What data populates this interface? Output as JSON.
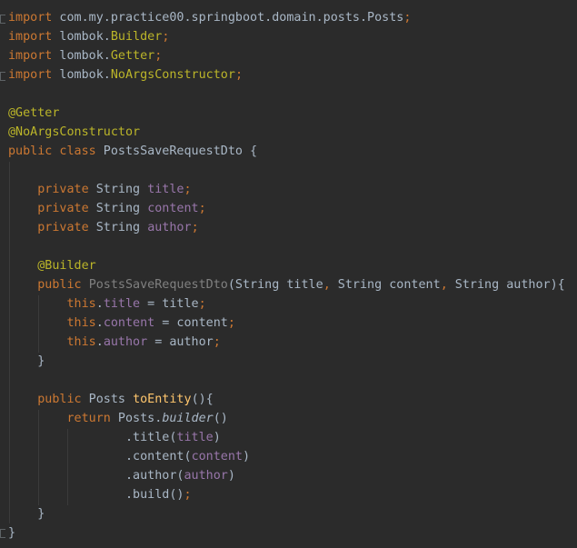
{
  "editor": {
    "colors": {
      "background": "#2b2b2b",
      "keyword": "#cc7832",
      "annotation": "#bbb529",
      "field": "#9876aa",
      "method": "#ffc66d",
      "plain": "#a9b7c6",
      "gray": "#808080"
    },
    "lines": [
      [
        {
          "t": "import",
          "c": "kw"
        },
        {
          "t": " com.my.practice00.springboot.domain.posts.Posts",
          "c": "plain"
        },
        {
          "t": ";",
          "c": "kw"
        }
      ],
      [
        {
          "t": "import",
          "c": "kw"
        },
        {
          "t": " lombok.",
          "c": "plain"
        },
        {
          "t": "Builder",
          "c": "ann"
        },
        {
          "t": ";",
          "c": "kw"
        }
      ],
      [
        {
          "t": "import",
          "c": "kw"
        },
        {
          "t": " lombok.",
          "c": "plain"
        },
        {
          "t": "Getter",
          "c": "ann"
        },
        {
          "t": ";",
          "c": "kw"
        }
      ],
      [
        {
          "t": "import",
          "c": "kw"
        },
        {
          "t": " lombok.",
          "c": "plain"
        },
        {
          "t": "NoArgsConstructor",
          "c": "ann"
        },
        {
          "t": ";",
          "c": "kw"
        }
      ],
      [],
      [
        {
          "t": "@Getter",
          "c": "ann"
        }
      ],
      [
        {
          "t": "@NoArgsConstructor",
          "c": "ann"
        }
      ],
      [
        {
          "t": "public class",
          "c": "kw"
        },
        {
          "t": " PostsSaveRequestDto {",
          "c": "plain"
        }
      ],
      [],
      [
        {
          "t": "    "
        },
        {
          "t": "private",
          "c": "kw"
        },
        {
          "t": " String ",
          "c": "plain"
        },
        {
          "t": "title",
          "c": "field"
        },
        {
          "t": ";",
          "c": "kw"
        }
      ],
      [
        {
          "t": "    "
        },
        {
          "t": "private",
          "c": "kw"
        },
        {
          "t": " String ",
          "c": "plain"
        },
        {
          "t": "content",
          "c": "field"
        },
        {
          "t": ";",
          "c": "kw"
        }
      ],
      [
        {
          "t": "    "
        },
        {
          "t": "private",
          "c": "kw"
        },
        {
          "t": " String ",
          "c": "plain"
        },
        {
          "t": "author",
          "c": "field"
        },
        {
          "t": ";",
          "c": "kw"
        }
      ],
      [],
      [
        {
          "t": "    "
        },
        {
          "t": "@Builder",
          "c": "ann"
        }
      ],
      [
        {
          "t": "    "
        },
        {
          "t": "public",
          "c": "kw"
        },
        {
          "t": " ",
          "c": "plain"
        },
        {
          "t": "PostsSaveRequestDto",
          "c": "gray"
        },
        {
          "t": "(String title",
          "c": "plain"
        },
        {
          "t": ",",
          "c": "kw"
        },
        {
          "t": " String content",
          "c": "plain"
        },
        {
          "t": ",",
          "c": "kw"
        },
        {
          "t": " String author){",
          "c": "plain"
        }
      ],
      [
        {
          "t": "        "
        },
        {
          "t": "this",
          "c": "kw"
        },
        {
          "t": ".",
          "c": "plain"
        },
        {
          "t": "title",
          "c": "field"
        },
        {
          "t": " = title",
          "c": "plain"
        },
        {
          "t": ";",
          "c": "kw"
        }
      ],
      [
        {
          "t": "        "
        },
        {
          "t": "this",
          "c": "kw"
        },
        {
          "t": ".",
          "c": "plain"
        },
        {
          "t": "content",
          "c": "field"
        },
        {
          "t": " = content",
          "c": "plain"
        },
        {
          "t": ";",
          "c": "kw"
        }
      ],
      [
        {
          "t": "        "
        },
        {
          "t": "this",
          "c": "kw"
        },
        {
          "t": ".",
          "c": "plain"
        },
        {
          "t": "author",
          "c": "field"
        },
        {
          "t": " = author",
          "c": "plain"
        },
        {
          "t": ";",
          "c": "kw"
        }
      ],
      [
        {
          "t": "    }",
          "c": "plain"
        }
      ],
      [],
      [
        {
          "t": "    "
        },
        {
          "t": "public",
          "c": "kw"
        },
        {
          "t": " Posts ",
          "c": "plain"
        },
        {
          "t": "toEntity",
          "c": "fn"
        },
        {
          "t": "(){",
          "c": "plain"
        }
      ],
      [
        {
          "t": "        "
        },
        {
          "t": "return",
          "c": "kw"
        },
        {
          "t": " Posts.",
          "c": "plain"
        },
        {
          "t": "builder",
          "c": "it plain"
        },
        {
          "t": "()",
          "c": "plain"
        }
      ],
      [
        {
          "t": "                "
        },
        {
          "t": ".title(",
          "c": "plain"
        },
        {
          "t": "title",
          "c": "field"
        },
        {
          "t": ")",
          "c": "plain"
        }
      ],
      [
        {
          "t": "                "
        },
        {
          "t": ".content(",
          "c": "plain"
        },
        {
          "t": "content",
          "c": "field"
        },
        {
          "t": ")",
          "c": "plain"
        }
      ],
      [
        {
          "t": "                "
        },
        {
          "t": ".author(",
          "c": "plain"
        },
        {
          "t": "author",
          "c": "field"
        },
        {
          "t": ")",
          "c": "plain"
        }
      ],
      [
        {
          "t": "                "
        },
        {
          "t": ".build()",
          "c": "plain"
        },
        {
          "t": ";",
          "c": "kw"
        }
      ],
      [
        {
          "t": "    }",
          "c": "plain"
        }
      ],
      [
        {
          "t": "}",
          "c": "plain"
        }
      ]
    ]
  }
}
